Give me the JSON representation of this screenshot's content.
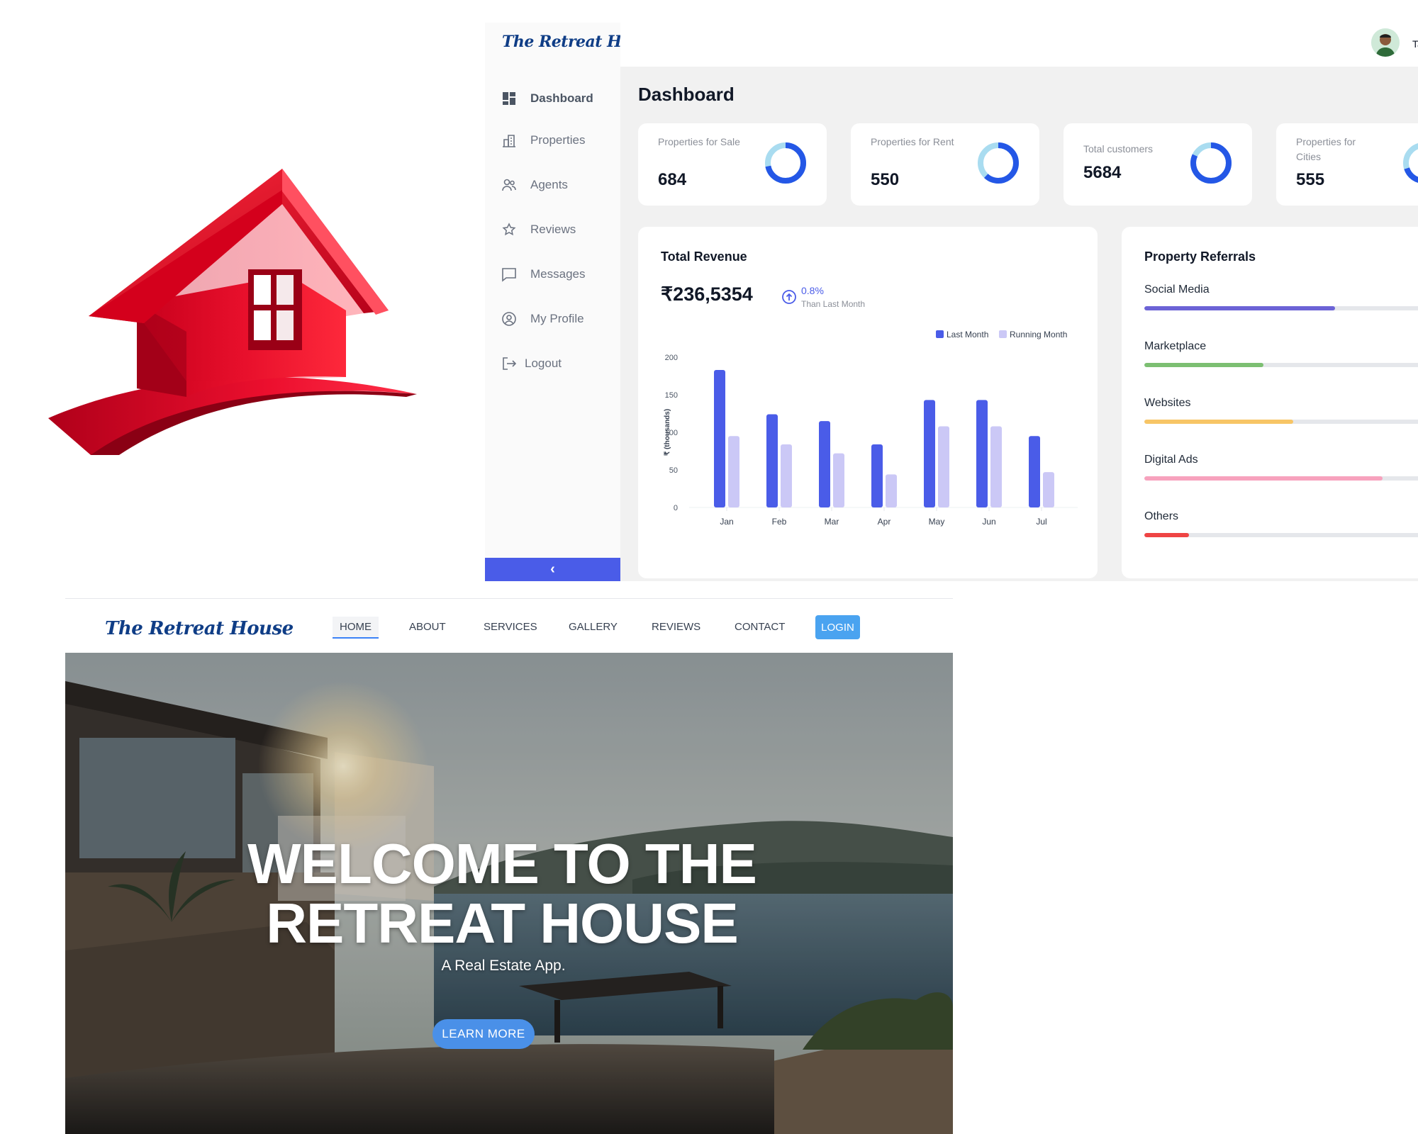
{
  "dashboard": {
    "brand": "The Retreat House",
    "title": "Dashboard",
    "user_initials": "Ta",
    "sidebar": {
      "items": [
        {
          "label": "Dashboard",
          "icon": "dashboard-grid-icon",
          "active": true
        },
        {
          "label": "Properties",
          "icon": "buildings-icon"
        },
        {
          "label": "Agents",
          "icon": "users-icon"
        },
        {
          "label": "Reviews",
          "icon": "star-icon"
        },
        {
          "label": "Messages",
          "icon": "chat-bubble-icon"
        },
        {
          "label": "My Profile",
          "icon": "user-circle-icon"
        },
        {
          "label": "Logout",
          "icon": "logout-icon"
        }
      ],
      "collapse_label": "‹"
    },
    "stats": [
      {
        "label": "Properties for Sale",
        "value": "684",
        "ring_fill": 0.72
      },
      {
        "label": "Properties for Rent",
        "value": "550",
        "ring_fill": 0.62
      },
      {
        "label": "Total customers",
        "value": "5684",
        "ring_fill": 0.82
      },
      {
        "label": "Properties for Cities",
        "value": "555",
        "ring_fill": 0.7
      }
    ],
    "revenue": {
      "title": "Total Revenue",
      "amount": "₹236,5354",
      "change": "0.8%",
      "change_note": "Than Last Month"
    },
    "referrals": {
      "title": "Property Referrals",
      "items": [
        {
          "label": "Social Media",
          "fraction": 0.64,
          "color": "#6c63d6"
        },
        {
          "label": "Marketplace",
          "fraction": 0.4,
          "color": "#7cbf72"
        },
        {
          "label": "Websites",
          "fraction": 0.5,
          "color": "#f7c566"
        },
        {
          "label": "Digital Ads",
          "fraction": 0.8,
          "color": "#f7a2bd"
        },
        {
          "label": "Others",
          "fraction": 0.15,
          "color": "#ef4444"
        }
      ]
    }
  },
  "chart_data": {
    "type": "bar",
    "categories": [
      "Jan",
      "Feb",
      "Mar",
      "Apr",
      "May",
      "Jun",
      "Jul"
    ],
    "series": [
      {
        "name": "Last Month",
        "values": [
          183,
          124,
          115,
          84,
          143,
          143,
          95
        ],
        "color": "#4a5ce8"
      },
      {
        "name": "Running Month",
        "values": [
          95,
          84,
          72,
          44,
          108,
          108,
          47
        ],
        "color": "#cbc8f6"
      }
    ],
    "ylabel": "₹ (thousands)",
    "ylim": [
      0,
      200
    ],
    "yticks": [
      0,
      50,
      100,
      150,
      200
    ],
    "legend_position": "top-right",
    "grid": false
  },
  "website": {
    "brand": "The Retreat House",
    "nav": [
      "HOME",
      "ABOUT",
      "SERVICES",
      "GALLERY",
      "REVIEWS",
      "CONTACT"
    ],
    "login_label": "LOGIN",
    "hero": {
      "title_line1": "WELCOME TO THE",
      "title_line2": "RETREAT HOUSE",
      "subtitle": "A Real Estate App.",
      "button": "LEARN MORE"
    }
  },
  "colors": {
    "accent": "#4a5ce8",
    "brand_red": "#e0102a",
    "brand_navy": "#0f3d86"
  }
}
